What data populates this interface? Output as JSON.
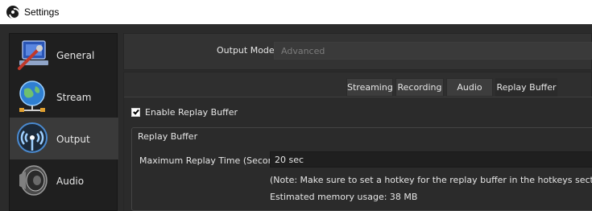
{
  "window": {
    "title": "Settings"
  },
  "sidebar": {
    "items": [
      {
        "label": "General",
        "icon": "general-settings-icon"
      },
      {
        "label": "Stream",
        "icon": "globe-network-icon"
      },
      {
        "label": "Output",
        "icon": "broadcast-antenna-icon",
        "selected": true
      },
      {
        "label": "Audio",
        "icon": "speaker-icon"
      }
    ]
  },
  "output_mode": {
    "label": "Output Mode",
    "value": "Advanced"
  },
  "tabs": [
    {
      "label": "Streaming"
    },
    {
      "label": "Recording"
    },
    {
      "label": "Audio"
    },
    {
      "label": "Replay Buffer",
      "active": true
    }
  ],
  "replay_buffer": {
    "enable_label": "Enable Replay Buffer",
    "enabled": true,
    "group_title": "Replay Buffer",
    "max_time_label": "Maximum Replay Time (Seconds)",
    "max_time_value": "20 sec",
    "note": "(Note: Make sure to set a hotkey for the replay buffer in the hotkeys section)",
    "memory_usage": "Estimated memory usage: 38 MB"
  },
  "colors": {
    "background": "#2b2b2b",
    "sidebar": "#1f1f1f",
    "selected": "#3a3a3a",
    "text": "#e6e6e6"
  }
}
